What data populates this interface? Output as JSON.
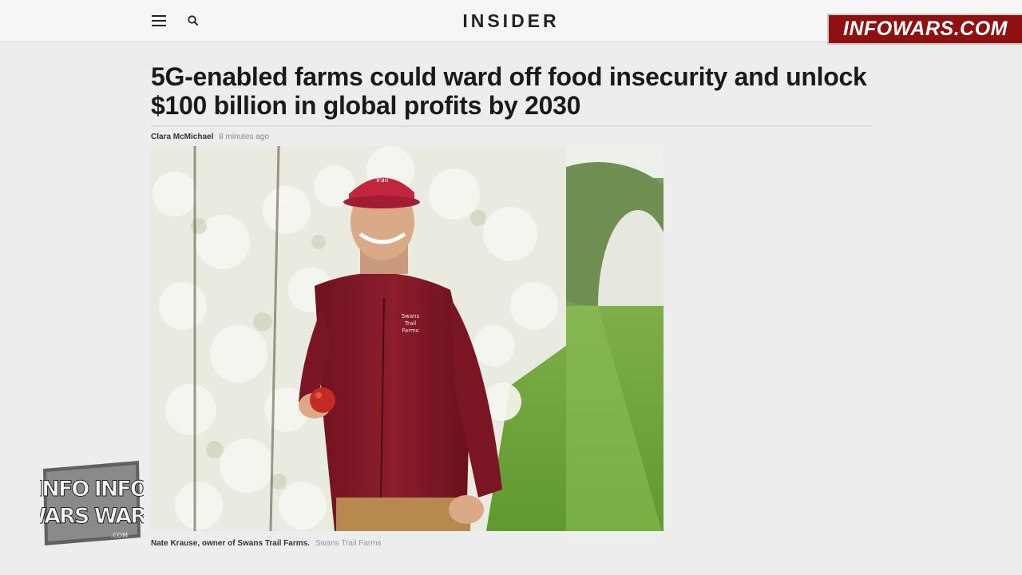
{
  "header": {
    "logo": "INSIDER",
    "menu_icon": "hamburger-menu-icon",
    "search_icon": "search-icon"
  },
  "brand_banner": {
    "text": "INFOWARS.COM",
    "color": "#8e1010"
  },
  "article": {
    "headline_line1": "5G-enabled farms could ward off food insecurity and unlock",
    "headline_line2": "$100 billion in global profits by 2030",
    "author": "Clara McMichael",
    "timestamp": "8 minutes ago",
    "caption": "Nate Krause, owner of Swans Trail Farms.",
    "credit": "Swans Trail Farms"
  },
  "photo": {
    "hat_text_line1": "Swans",
    "hat_text_line2": "Trail",
    "hat_text_line3": "Farms"
  },
  "watermark": {
    "line1": "INFO INFO",
    "line2": "WARS WARS",
    "domain": ".COM"
  }
}
